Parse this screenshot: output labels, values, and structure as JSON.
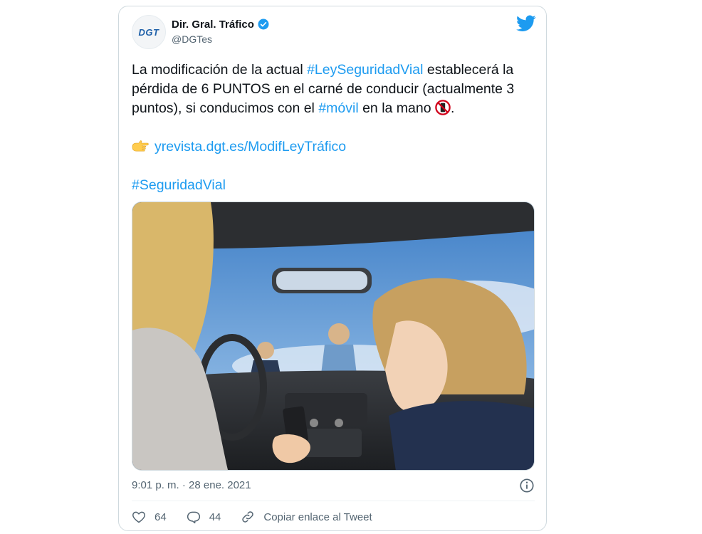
{
  "account": {
    "display_name": "Dir. Gral. Tráfico",
    "handle": "@DGTes",
    "logo_text": "DGT",
    "verified_icon": "verified-badge-icon"
  },
  "tweet": {
    "line1_a": "La modificación de la actual ",
    "hashtag_ley": "#LeySeguridadVial",
    "line1_b": " establecerá la pérdida de 6 PUNTOS en el carné de conducir (actualmente 3 puntos), si conducimos con el ",
    "hashtag_movil": "#móvil",
    "line1_c": " en la mano ",
    "line1_end": ".",
    "link": "yrevista.dgt.es/ModifLeyTráfico",
    "hashtag_seguridad": "#SeguridadVial"
  },
  "meta": {
    "timestamp": "9:01 p. m. · 28 ene. 2021"
  },
  "actions": {
    "likes": "64",
    "replies": "44",
    "copy_link": "Copiar enlace al Tweet"
  },
  "colors": {
    "link": "#1d9bf0",
    "twitter_blue": "#1d9bf0",
    "muted": "#536471"
  }
}
